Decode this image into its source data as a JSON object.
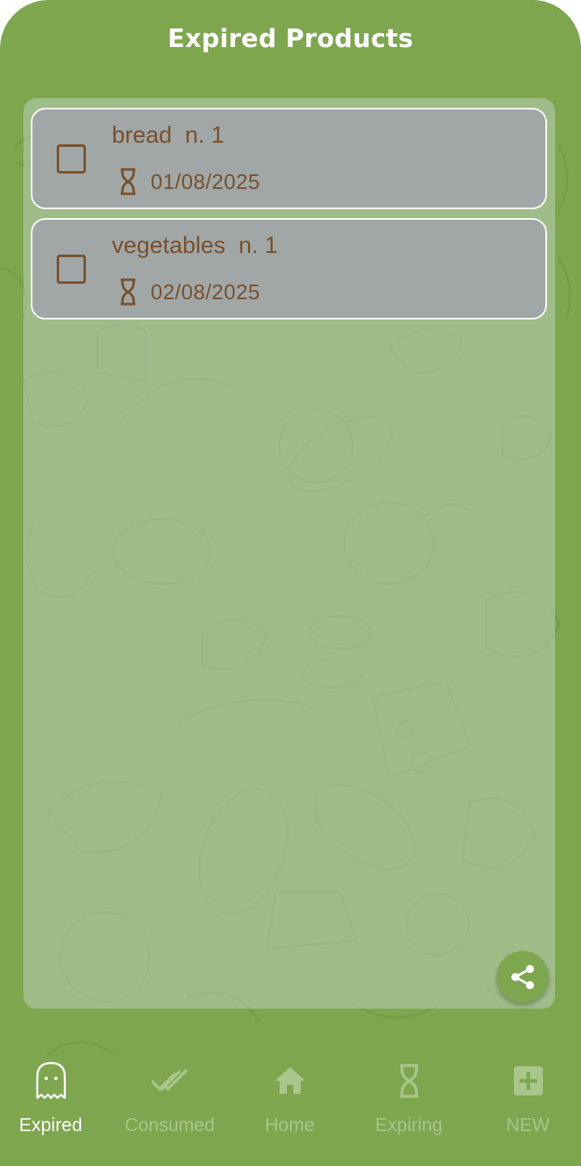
{
  "header": {
    "title": "Expired Products"
  },
  "products": [
    {
      "name": "bread  n. 1",
      "date": "01/08/2025"
    },
    {
      "name": "vegetables  n. 1",
      "date": "02/08/2025"
    }
  ],
  "nav": {
    "items": [
      {
        "label": "Expired",
        "icon": "ghost-icon",
        "active": true
      },
      {
        "label": "Consumed",
        "icon": "double-check-icon",
        "active": false
      },
      {
        "label": "Home",
        "icon": "home-icon",
        "active": false
      },
      {
        "label": "Expiring",
        "icon": "hourglass-icon",
        "active": false
      },
      {
        "label": "NEW",
        "icon": "add-box-icon",
        "active": false
      }
    ]
  },
  "colors": {
    "background": "#7ea64f",
    "card": "#a0a7a6",
    "text_brown": "#7a4f2b",
    "nav_active": "#ffffff",
    "nav_inactive": "#a9c68b"
  }
}
